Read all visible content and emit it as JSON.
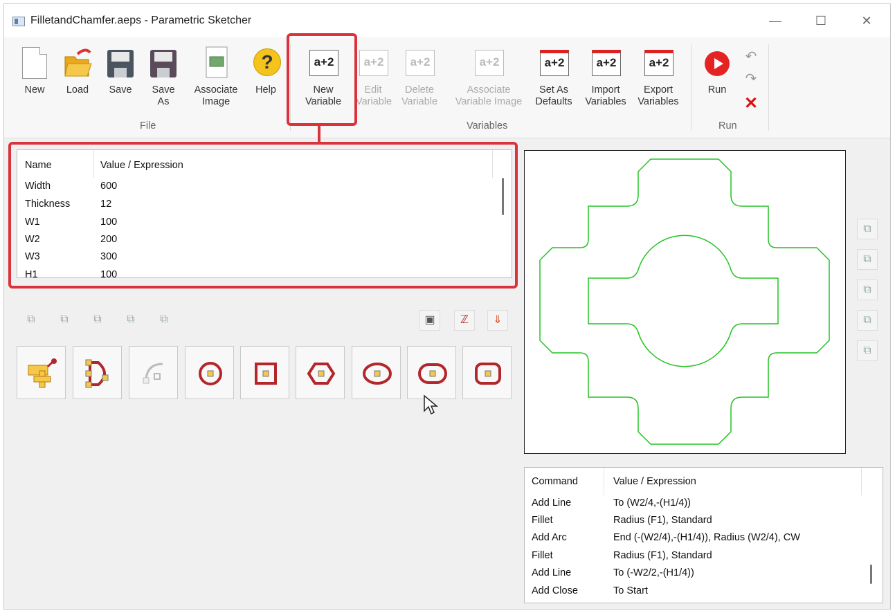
{
  "window": {
    "title": "FilletandChamfer.aeps - Parametric Sketcher",
    "controls": {
      "minimize": "—",
      "maximize": "☐",
      "close": "✕"
    }
  },
  "ribbon": {
    "file_group": {
      "label": "File",
      "buttons": {
        "new": "New",
        "load": "Load",
        "save": "Save",
        "save_as": "Save\nAs",
        "associate_image": "Associate\nImage",
        "help": "Help"
      }
    },
    "variables_group": {
      "label": "Variables",
      "buttons": {
        "new_variable": "New\nVariable",
        "edit_variable": "Edit\nVariable",
        "delete_variable": "Delete\nVariable",
        "associate_variable_image": "Associate\nVariable Image",
        "set_as_defaults": "Set As\nDefaults",
        "import_variables": "Import\nVariables",
        "export_variables": "Export\nVariables"
      },
      "icon_text": "a+2"
    },
    "run_group": {
      "label": "Run",
      "buttons": {
        "run": "Run"
      }
    }
  },
  "variables_table": {
    "headers": [
      "Name",
      "Value / Expression"
    ],
    "rows": [
      [
        "Width",
        "600"
      ],
      [
        "Thickness",
        "12"
      ],
      [
        "W1",
        "100"
      ],
      [
        "W2",
        "200"
      ],
      [
        "W3",
        "300"
      ],
      [
        "H1",
        "100"
      ]
    ]
  },
  "commands_table": {
    "headers": [
      "Command",
      "Value / Expression"
    ],
    "rows": [
      [
        "Add Line",
        "To (W2/4,-(H1/4))"
      ],
      [
        "Fillet",
        "Radius (F1), Standard"
      ],
      [
        "Add Arc",
        "End (-(W2/4),-(H1/4)), Radius (W2/4), CW"
      ],
      [
        "Fillet",
        "Radius (F1), Standard"
      ],
      [
        "Add Line",
        "To (-W2/2,-(H1/4))"
      ],
      [
        "Add Close",
        "To Start"
      ]
    ]
  },
  "view_buttons": [
    "view-iso-1",
    "view-iso-2",
    "view-iso-3",
    "view-iso-4",
    "view-iso-5"
  ],
  "tool_buttons": [
    "add-point-tool",
    "path-tool",
    "node-tool",
    "circle-tool",
    "square-tool",
    "hexagon-tool",
    "ellipse-tool",
    "obround-tool",
    "rounded-rect-tool"
  ],
  "colors": {
    "highlight": "#d9343c",
    "shape_stroke": "#22c322",
    "accent_red": "#b3262b"
  }
}
